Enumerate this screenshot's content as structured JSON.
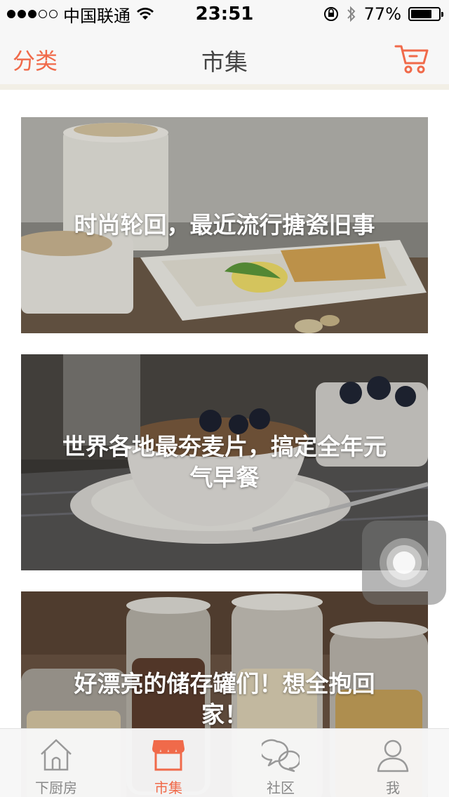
{
  "status_bar": {
    "carrier": "中国联通",
    "time": "23:51",
    "battery": "77%",
    "battery_level": 0.77,
    "signal_bars": 3
  },
  "nav": {
    "left_label": "分类",
    "title": "市集",
    "right_icon": "cart-icon"
  },
  "feed": {
    "cards": [
      {
        "title": "时尚轮回，最近流行搪瓷旧事"
      },
      {
        "title": "世界各地最夯麦片，搞定全年元气早餐"
      },
      {
        "title": "好漂亮的储存罐们！想全抱回家！"
      }
    ]
  },
  "tab_bar": {
    "items": [
      {
        "label": "下厨房",
        "icon": "house-icon"
      },
      {
        "label": "市集",
        "icon": "shop-icon",
        "active": true
      },
      {
        "label": "社区",
        "icon": "chat-bubbles-icon"
      },
      {
        "label": "我",
        "icon": "person-icon"
      }
    ]
  },
  "colors": {
    "accent": "#f06a4a",
    "nav_bg": "#f7f7f7"
  }
}
